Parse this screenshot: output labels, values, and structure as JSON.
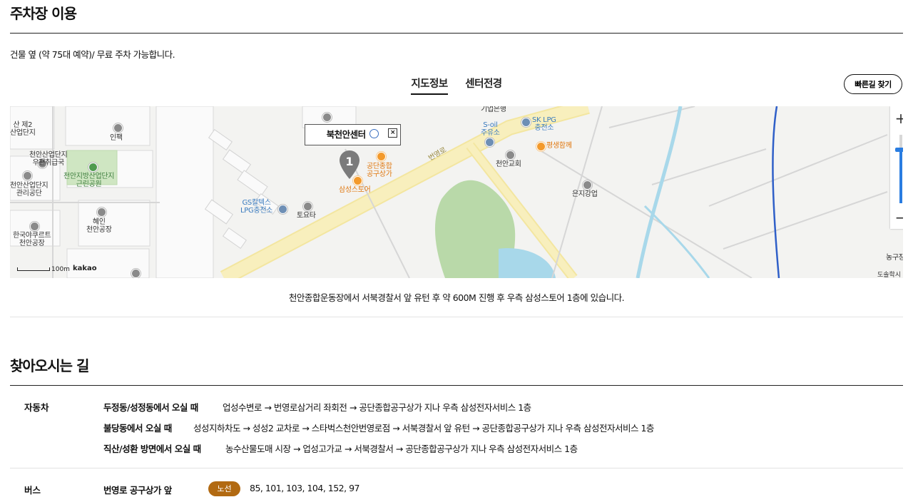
{
  "parking": {
    "title": "주차장 이용",
    "description": "건물 옆 (약 75대 예약)/ 무료 주차 가능합니다."
  },
  "tabs": [
    {
      "label": "지도정보",
      "active": true
    },
    {
      "label": "센터전경",
      "active": false
    }
  ],
  "route_button": "빠른길 찾기",
  "map": {
    "popup_title": "북천안센터",
    "marker_number": "1",
    "scale_label": "100m",
    "provider": "kakao",
    "copyright": "도솔학시",
    "zoom_in": "+",
    "zoom_out": "−",
    "labels": {
      "l1": "기업은행",
      "l2": "S-oil\n주유소",
      "l3": "SK LPG\n충전소",
      "l4": "평생함께",
      "l5": "천안교회",
      "l6": "은지강업",
      "l7": "공단종합\n공구상가",
      "l8": "삼성스토어",
      "l9": "번영로",
      "l10": "GS칼텍스\nLPG충전소",
      "l11": "토요타",
      "l12": "인팩",
      "l13": "천안산업단지\n우편취급국",
      "l14": "천안지방산업단지\n근린공원",
      "l15": "천안산업단지\n관리공단",
      "l16": "혜인\n천안공장",
      "l17": "한국야쿠르트\n천안공장",
      "l18": "산 제2\n산업단지",
      "l19": "농구장"
    }
  },
  "map_caption": "천안종합운동장에서 서북경찰서 앞 유턴 후 약 600M 진행 후 우측 삼성스토어 1층에 있습니다.",
  "directions": {
    "title": "찾아오시는 길",
    "car": {
      "label": "자동차",
      "routes": [
        {
          "from": "두정동/성정동에서 오실 때",
          "path": "업성수변로 → 번영로삼거리 좌회전 → 공단종합공구상가 지나 우측 삼성전자서비스 1층"
        },
        {
          "from": "불당동에서 오실 때",
          "path": "성성지하차도 → 성성2 교차로 → 스타벅스천안번영로점 → 서북경찰서 앞 유턴 → 공단종합공구상가 지나 우측 삼성전자서비스 1층"
        },
        {
          "from": "직산/성환 방면에서 오실 때",
          "path": "농수산물도매 시장 → 업성고가교 → 서북경찰서 → 공단종합공구상가 지나 우측 삼성전자서비스 1층"
        }
      ]
    },
    "bus": {
      "label": "버스",
      "stop": "번영로 공구상가 앞",
      "badge": "노선",
      "lines": "85, 101, 103, 104, 152, 97"
    }
  },
  "colors": {
    "accent_badge": "#b26a12",
    "zoom_slider": "#2a7de1",
    "road_main": "#f7eeb0",
    "park": "#b9d9a9",
    "water": "#a8d8ea"
  }
}
